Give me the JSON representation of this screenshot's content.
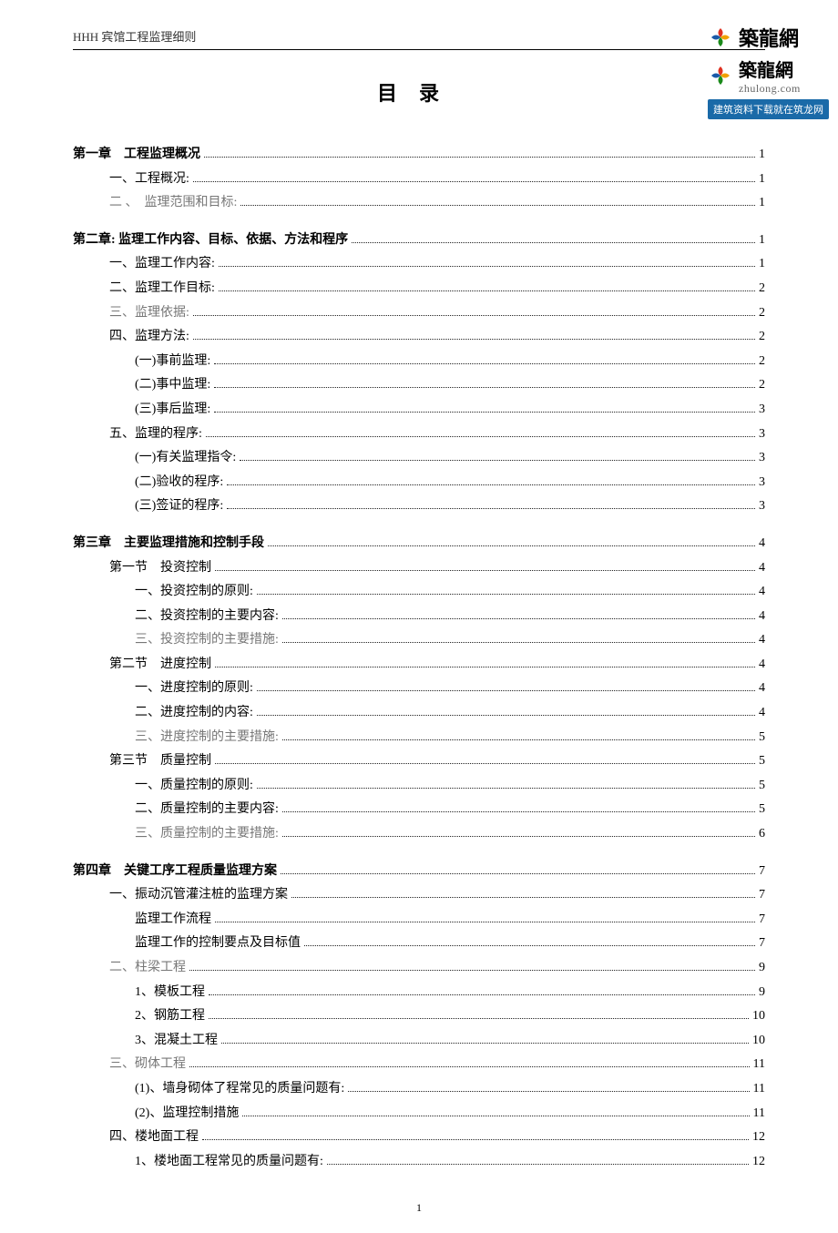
{
  "header": "HHH 宾馆工程监理细则",
  "logo": {
    "brand_cn": "築龍網",
    "brand_py": "zhulong.com",
    "banner": "建筑资料下载就在筑龙网"
  },
  "title": "目录",
  "page_number": "1",
  "toc": [
    {
      "text": "第一章　工程监理概况",
      "page": "1",
      "indent": 1,
      "bold": true
    },
    {
      "text": "一、工程概况:",
      "page": "1",
      "indent": 2
    },
    {
      "text": "二 、　监理范围和目标:",
      "page": "1",
      "indent": 2,
      "faint": true
    },
    {
      "gap": true
    },
    {
      "text": "第二章:  监理工作内容、目标、依据、方法和程序",
      "page": "1",
      "indent": 1,
      "bold": true
    },
    {
      "text": "一、监理工作内容:",
      "page": "1",
      "indent": 2
    },
    {
      "text": "二、监理工作目标:",
      "page": "2",
      "indent": 2
    },
    {
      "text": "三、监理依据:",
      "page": "2",
      "indent": 2,
      "faint": true
    },
    {
      "text": "四、监理方法:",
      "page": "2",
      "indent": 2
    },
    {
      "text": "(一)事前监理:",
      "page": "2",
      "indent": 3
    },
    {
      "text": "(二)事中监理:",
      "page": "2",
      "indent": 3
    },
    {
      "text": "(三)事后监理:",
      "page": "3",
      "indent": 3
    },
    {
      "text": "五、监理的程序:",
      "page": "3",
      "indent": 2
    },
    {
      "text": "(一)有关监理指令:",
      "page": "3",
      "indent": 3
    },
    {
      "text": "(二)验收的程序:",
      "page": "3",
      "indent": 3
    },
    {
      "text": "(三)签证的程序:",
      "page": "3",
      "indent": 3
    },
    {
      "gap": true
    },
    {
      "text": "第三章　主要监理措施和控制手段",
      "page": "4",
      "indent": 1,
      "bold": true
    },
    {
      "text": "第一节　投资控制",
      "page": "4",
      "indent": 2
    },
    {
      "text": "一、投资控制的原则:",
      "page": "4",
      "indent": 3
    },
    {
      "text": "二、投资控制的主要内容:",
      "page": "4",
      "indent": 3
    },
    {
      "text": "三、投资控制的主要措施:",
      "page": "4",
      "indent": 3,
      "faint": true
    },
    {
      "text": "第二节　进度控制",
      "page": "4",
      "indent": 2
    },
    {
      "text": "一、进度控制的原则:",
      "page": "4",
      "indent": 3
    },
    {
      "text": "二、进度控制的内容:",
      "page": "4",
      "indent": 3
    },
    {
      "text": "三、进度控制的主要措施:",
      "page": "5",
      "indent": 3,
      "faint": true
    },
    {
      "text": "第三节　质量控制",
      "page": "5",
      "indent": 2
    },
    {
      "text": "一、质量控制的原则:",
      "page": "5",
      "indent": 3
    },
    {
      "text": "二、质量控制的主要内容:",
      "page": "5",
      "indent": 3
    },
    {
      "text": "三、质量控制的主要措施:",
      "page": "6",
      "indent": 3,
      "faint": true
    },
    {
      "gap": true
    },
    {
      "text": "第四章　关键工序工程质量监理方案",
      "page": "7",
      "indent": 1,
      "bold": true
    },
    {
      "text": "一、振动沉管灌注桩的监理方案",
      "page": "7",
      "indent": 2
    },
    {
      "text": "监理工作流程",
      "page": "7",
      "indent": 3
    },
    {
      "text": "监理工作的控制要点及目标值",
      "page": "7",
      "indent": 3
    },
    {
      "text": "二、柱梁工程",
      "page": "9",
      "indent": 2,
      "faint": true
    },
    {
      "text": "1、模板工程",
      "page": "9",
      "indent": 3
    },
    {
      "text": "2、钢筋工程",
      "page": "10",
      "indent": 3
    },
    {
      "text": "3、混凝土工程",
      "page": "10",
      "indent": 3
    },
    {
      "text": "三、砌体工程",
      "page": "11",
      "indent": 2,
      "faint": true
    },
    {
      "text": "(1)、墙身砌体了程常见的质量问题有:",
      "page": "11",
      "indent": 3
    },
    {
      "text": "(2)、监理控制措施",
      "page": "11",
      "indent": 3
    },
    {
      "text": "四、楼地面工程",
      "page": "12",
      "indent": 2
    },
    {
      "text": "1、楼地面工程常见的质量问题有:",
      "page": "12",
      "indent": 3
    }
  ]
}
